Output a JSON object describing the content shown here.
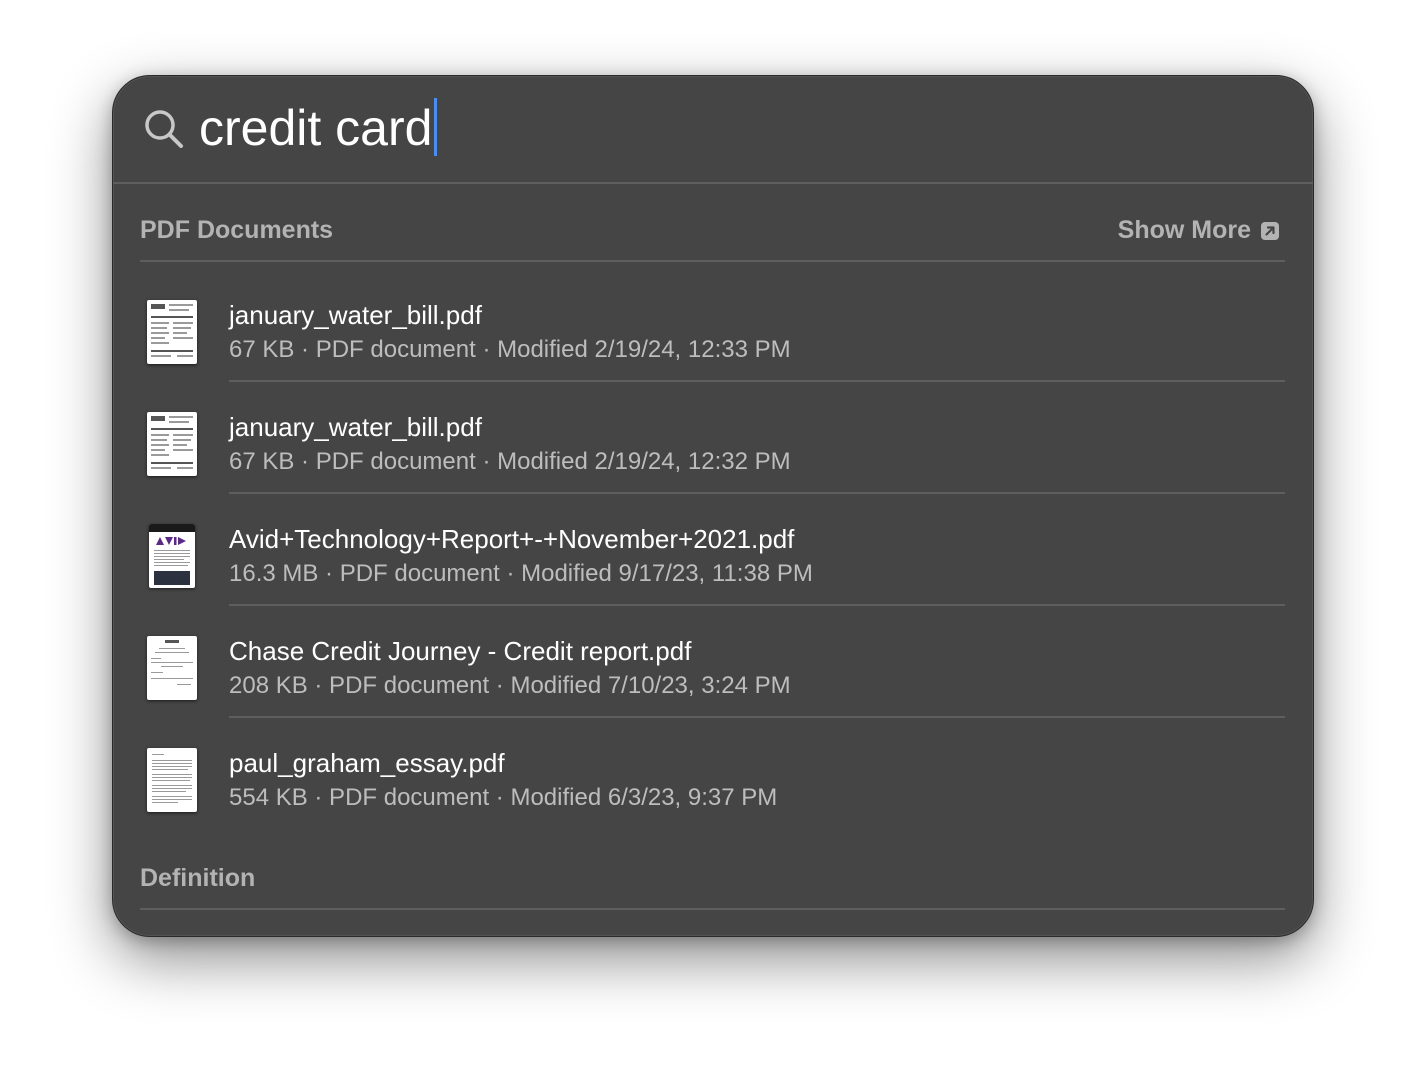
{
  "search": {
    "query": "credit card"
  },
  "sections": {
    "pdf": {
      "title": "PDF Documents",
      "show_more": "Show More"
    },
    "definition": {
      "title": "Definition"
    }
  },
  "results": [
    {
      "name": "january_water_bill.pdf",
      "meta": "67 KB · PDF document · Modified 2/19/24, 12:33 PM",
      "thumb_icon": "water-bill-thumbnail-icon"
    },
    {
      "name": "january_water_bill.pdf",
      "meta": "67 KB · PDF document · Modified 2/19/24, 12:32 PM",
      "thumb_icon": "water-bill-thumbnail-icon"
    },
    {
      "name": "Avid+Technology+Report+-+November+2021.pdf",
      "meta": "16.3 MB · PDF document · Modified 9/17/23, 11:38 PM",
      "thumb_icon": "avid-report-thumbnail-icon"
    },
    {
      "name": "Chase Credit Journey - Credit report.pdf",
      "meta": "208 KB · PDF document · Modified 7/10/23, 3:24 PM",
      "thumb_icon": "credit-report-thumbnail-icon"
    },
    {
      "name": "paul_graham_essay.pdf",
      "meta": "554 KB · PDF document · Modified 6/3/23, 9:37 PM",
      "thumb_icon": "essay-thumbnail-icon"
    }
  ],
  "colors": {
    "panel_bg": "#454545",
    "caret": "#4a8ef2",
    "primary_text": "#ffffff",
    "secondary_text": "#bdbdbd",
    "avid_purple": "#5b2a86"
  }
}
